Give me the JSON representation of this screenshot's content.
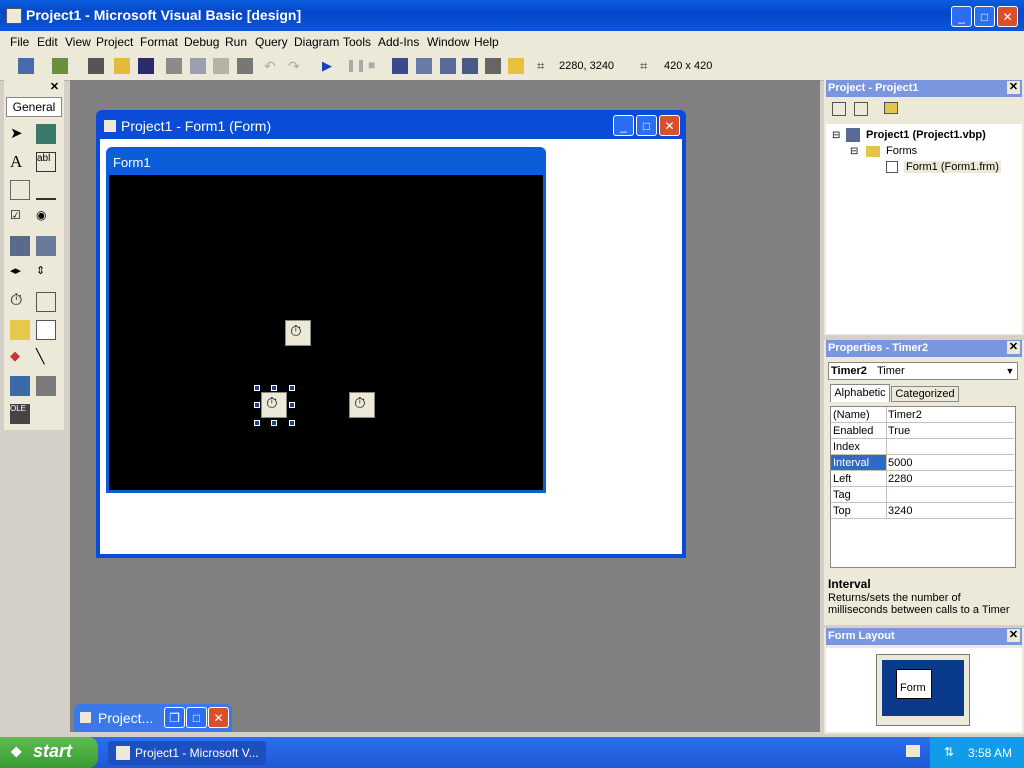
{
  "window": {
    "title": "Project1 - Microsoft Visual Basic [design]"
  },
  "menu": [
    "File",
    "Edit",
    "View",
    "Project",
    "Format",
    "Debug",
    "Run",
    "Query",
    "Diagram",
    "Tools",
    "Add-Ins",
    "Window",
    "Help"
  ],
  "toolbar": {
    "position": "2280, 3240",
    "size": "420 x 420"
  },
  "toolbox": {
    "tab_label": "General"
  },
  "designer": {
    "title": "Project1 - Form1 (Form)",
    "form_caption": "Form1"
  },
  "minimized": {
    "title": "Project..."
  },
  "project_explorer": {
    "title": "Project - Project1",
    "root": "Project1 (Project1.vbp)",
    "folder": "Forms",
    "item": "Form1 (Form1.frm)"
  },
  "properties": {
    "title": "Properties - Timer2",
    "object_name": "Timer2",
    "object_type": "Timer",
    "tabs": [
      "Alphabetic",
      "Categorized"
    ],
    "rows": [
      {
        "key": "(Name)",
        "value": "Timer2"
      },
      {
        "key": "Enabled",
        "value": "True"
      },
      {
        "key": "Index",
        "value": ""
      },
      {
        "key": "Interval",
        "value": "5000"
      },
      {
        "key": "Left",
        "value": "2280"
      },
      {
        "key": "Tag",
        "value": ""
      },
      {
        "key": "Top",
        "value": "3240"
      }
    ],
    "selected_row": "Interval",
    "desc_title": "Interval",
    "desc_text": "Returns/sets the number of milliseconds between calls to a Timer"
  },
  "form_layout": {
    "title": "Form Layout",
    "preview_label": "Form"
  },
  "taskbar": {
    "start_label": "start",
    "task_label": "Project1 - Microsoft V...",
    "clock": "3:58 AM"
  },
  "colors": {
    "titlebar": "#0a5de0",
    "panel_title": "#7a96df",
    "selection": "#316ac5"
  }
}
